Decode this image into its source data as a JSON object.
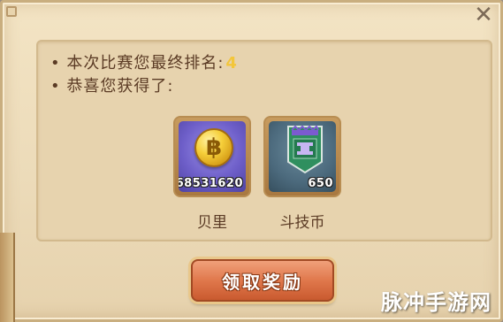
{
  "dialog": {
    "line1_prefix": "本次比赛您最终排名:",
    "rank": "4",
    "line2": "恭喜您获得了:",
    "close_symbol": "✕"
  },
  "rewards": [
    {
      "name": "贝里",
      "count": "68531620",
      "icon": "coin-icon"
    },
    {
      "name": "斗技币",
      "count": "650",
      "icon": "arena-token-banner-icon"
    }
  ],
  "claim_button": {
    "label": "领取奖励"
  },
  "watermark": "脉冲手游网",
  "colors": {
    "rank": "#f3c63a",
    "button": "#e0784c",
    "text": "#5b3b25"
  }
}
